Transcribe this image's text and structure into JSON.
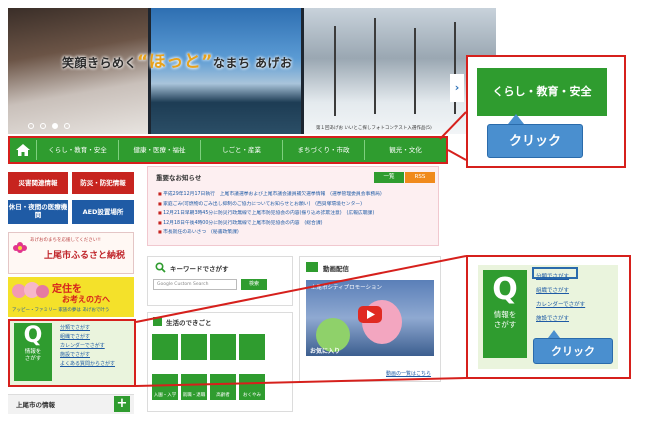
{
  "hero": {
    "title_pre": "笑顔きらめく",
    "title_accent": "“ほっと”",
    "title_post": "なまち あげお",
    "caption": "第１回あげお いいとこ探しフォトコンテスト入選作品(5)",
    "next_glyph": "›"
  },
  "nav": {
    "home_icon": "home-icon",
    "items": [
      "くらし・教育・安全",
      "健康・医療・福祉",
      "しごと・産業",
      "まちづくり・市政",
      "観光・文化"
    ]
  },
  "left": {
    "disaster": "災害関連情報",
    "crime": "防災・防犯情報",
    "night_medical": "休日・夜間の医療機関",
    "aed": "AED設置場所",
    "furusato_small": "あげおのまちを応援してください!!",
    "furusato_big": "上尾市ふるさと納税",
    "teiju_line1": "定住を",
    "teiju_line2": "お考えの方へ",
    "teiju_small": "アッピー・ファミリー 家族の夢は あげおで叶う",
    "search_label": "情報を\nさがす",
    "search_links": [
      "分類でさがす",
      "組織でさがす",
      "カレンダーでさがす",
      "施設でさがす",
      "よくある質問からさがす"
    ],
    "city_info": "上尾市の情報"
  },
  "notice": {
    "heading": "重要なお知らせ",
    "tab_list": "一覧",
    "tab_rss": "RSS",
    "items": [
      "平成29年12月17日執行　上尾市議選挙および上尾市議会議員補欠選挙情報　(選挙管理委員会事務局)",
      "家庭ごみ(可燃物のごみ出し抑制のご協力についてお知らせとお願い)　(西貝塚環境センター)",
      "12月21日早朝3時45分に防災行政無線で上尾市防犯協会の内容(振り込め詐欺注意)　(広報広聴課)",
      "12月18日午後4時00分に防災行政無線で上尾市防犯協会の内容　(総合課)",
      "市長就任のあいさつ　(秘書政策課)"
    ]
  },
  "keyword": {
    "title": "キーワードでさがす",
    "placeholder": "Google Custom Search",
    "button": "検索"
  },
  "life": {
    "title": "生活のできごと",
    "tiles": [
      "入園・入学",
      "就職・退職",
      "高齢者",
      "おくやみ"
    ]
  },
  "video": {
    "title": "動画配信",
    "caption": "上尾市シティプロモーション",
    "banner": "お気に入り",
    "more": "動画の一覧はこちら"
  },
  "callout_nav": {
    "button": "くらし・教育・安全",
    "click": "クリック"
  },
  "callout_search": {
    "label": "情報を\nさがす",
    "links": [
      "分類でさがす",
      "組織でさがす",
      "カレンダーでさがす",
      "施設でさがす"
    ],
    "click": "クリック"
  },
  "colors": {
    "green": "#2f9c2f",
    "red": "#d6201c",
    "blue": "#4a8fcf"
  }
}
